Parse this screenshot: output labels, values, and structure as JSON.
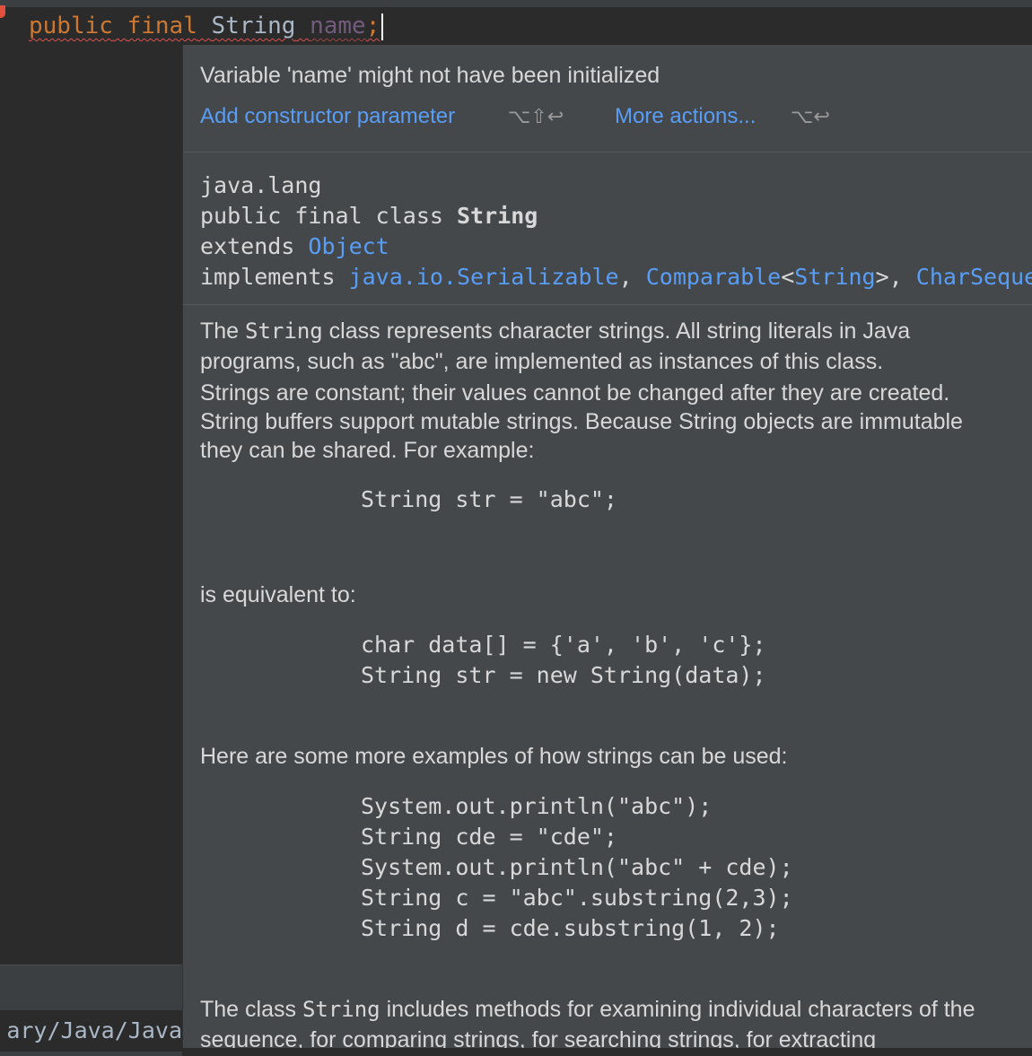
{
  "editor": {
    "kw_public": "public",
    "kw_final": "final",
    "type": "String",
    "field": "name",
    "semicolon": ";"
  },
  "popup": {
    "error_message": "Variable 'name' might not have been initialized",
    "actions": [
      {
        "label": "Add constructor parameter",
        "shortcut": "⌥⇧↩"
      },
      {
        "label": "More actions...",
        "shortcut": "⌥↩"
      }
    ],
    "declaration": {
      "package": "java.lang",
      "modifiers": "public final class ",
      "class_name": "String",
      "extends_kw": "extends ",
      "superclass": "Object",
      "implements_kw": "implements ",
      "interface1": "java.io.Serializable",
      "comma1": ", ",
      "interface2": "Comparable",
      "type_open": "<",
      "type_param": "String",
      "type_close": ">, ",
      "interface3": "CharSequence"
    },
    "doc": {
      "p1_pre": "The ",
      "p1_code": "String",
      "p1_post": " class represents character strings. All string literals in Java",
      "p1_line2": "programs, such as \"abc\", are implemented as instances of this class.",
      "p2_line1": "Strings are constant; their values cannot be changed after they are created.",
      "p2_line2": "String buffers support mutable strings. Because String objects are immutable",
      "p2_line3": "they can be shared. For example:",
      "ex1": "String str = \"abc\";",
      "equiv": "is equivalent to:",
      "ex2_l1": "char data[] = {'a', 'b', 'c'};",
      "ex2_l2": "String str = new String(data);",
      "more": "Here are some more examples of how strings can be used:",
      "ex3_l1": "System.out.println(\"abc\");",
      "ex3_l2": "String cde = \"cde\";",
      "ex3_l3": "System.out.println(\"abc\" + cde);",
      "ex3_l4": "String c = \"abc\".substring(2,3);",
      "ex3_l5": "String d = cde.substring(1, 2);",
      "p3_pre": "The class ",
      "p3_code": "String",
      "p3_post": " includes methods for examining individual characters of the",
      "p3_line2": "sequence, for comparing strings, for searching strings, for extracting"
    }
  },
  "statusbar": {
    "path": "ary/Java/Java"
  },
  "colors": {
    "keyword": "#cc7832",
    "link": "#589df6",
    "popup_bg": "#45484b",
    "editor_bg": "#2b2b2b",
    "error": "#e04f4f"
  }
}
